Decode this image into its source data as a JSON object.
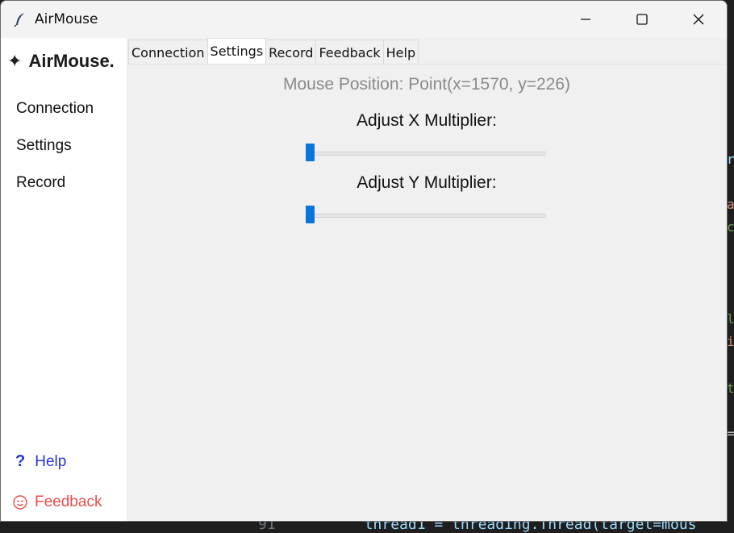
{
  "window": {
    "title": "AirMouse",
    "app_icon": "feather-icon",
    "controls": [
      "minimize-icon",
      "maximize-icon",
      "close-icon"
    ]
  },
  "sidebar": {
    "brand_icon": "sparkle-icon",
    "brand_symbol": "✦",
    "brand": "AirMouse.",
    "items": [
      {
        "label": "Connection"
      },
      {
        "label": "Settings"
      },
      {
        "label": "Record"
      }
    ],
    "help": {
      "icon": "question-icon",
      "symbol": "?",
      "label": "Help",
      "color": "#2a35d6"
    },
    "feedback": {
      "icon": "smile-icon",
      "label": "Feedback",
      "color": "#ef4b4b"
    }
  },
  "tabs": [
    {
      "label": "Connection",
      "active": false
    },
    {
      "label": "Settings",
      "active": true
    },
    {
      "label": "Record",
      "active": false
    },
    {
      "label": "Feedback",
      "active": false
    },
    {
      "label": "Help",
      "active": false
    }
  ],
  "settings": {
    "mouse_position": "Mouse Position: Point(x=1570, y=226)",
    "x_slider": {
      "label": "Adjust X Multiplier:",
      "value_fraction": 0
    },
    "y_slider": {
      "label": "Adjust Y Multiplier:",
      "value_fraction": 0
    }
  },
  "colors": {
    "accent": "#0a74da",
    "window_bg": "#f0f0f0",
    "sidebar_bg": "#ffffff",
    "muted_text": "#8a8a8a"
  },
  "background_editor": {
    "line_number": "91",
    "code": "thread1 = threading.Thread(target=mous"
  }
}
